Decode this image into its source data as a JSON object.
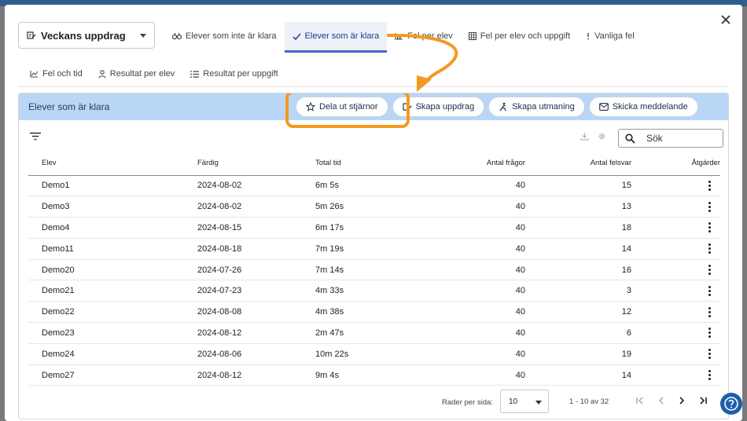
{
  "header": {
    "select_value": "Veckans uppdrag",
    "tabs_row1": [
      {
        "label": "Elever som inte är klara",
        "icon": "binoculars-icon"
      },
      {
        "label": "Elever som är klara",
        "icon": "check-icon",
        "active": true
      },
      {
        "label": "Fel per elev",
        "icon": "chart-icon"
      },
      {
        "label": "Fel per elev och uppgift",
        "icon": "grid-icon"
      },
      {
        "label": "Vanliga fel",
        "icon": "exclamation-icon"
      }
    ],
    "tabs_row2": [
      {
        "label": "Fel och tid",
        "icon": "line-chart-icon"
      },
      {
        "label": "Resultat per elev",
        "icon": "person-icon"
      },
      {
        "label": "Resultat per uppgift",
        "icon": "list-icon"
      }
    ]
  },
  "panel": {
    "title": "Elever som är klara",
    "actions": [
      {
        "label": "Dela ut stjärnor",
        "icon": "star-icon"
      },
      {
        "label": "Skapa uppdrag",
        "icon": "edit-icon"
      },
      {
        "label": "Skapa utmaning",
        "icon": "climber-icon"
      },
      {
        "label": "Skicka meddelande",
        "icon": "mail-icon"
      }
    ],
    "search_placeholder": "Sök"
  },
  "table": {
    "columns": [
      "Elev",
      "Färdig",
      "Total tid",
      "Antal frågor",
      "Antal felsvar",
      "Åtgärder"
    ],
    "rows": [
      [
        "Demo1",
        "2024-08-02",
        "6m 5s",
        "40",
        "15"
      ],
      [
        "Demo3",
        "2024-08-02",
        "5m 26s",
        "40",
        "13"
      ],
      [
        "Demo4",
        "2024-08-15",
        "6m 17s",
        "40",
        "18"
      ],
      [
        "Demo11",
        "2024-08-18",
        "7m 19s",
        "40",
        "14"
      ],
      [
        "Demo20",
        "2024-07-26",
        "7m 14s",
        "40",
        "16"
      ],
      [
        "Demo21",
        "2024-07-23",
        "4m 33s",
        "40",
        "3"
      ],
      [
        "Demo22",
        "2024-08-08",
        "4m 38s",
        "40",
        "12"
      ],
      [
        "Demo23",
        "2024-08-12",
        "2m 47s",
        "40",
        "6"
      ],
      [
        "Demo24",
        "2024-08-06",
        "10m 22s",
        "40",
        "19"
      ],
      [
        "Demo27",
        "2024-08-12",
        "9m 4s",
        "40",
        "14"
      ]
    ]
  },
  "footer": {
    "rows_per_page_label": "Rader per sida:",
    "rows_per_page_value": "10",
    "range_text": "1 - 10 av 32"
  },
  "colors": {
    "highlight": "#f39a1e",
    "panel_header": "#b9d6f6",
    "active_tab": "#3d6fbd",
    "help_button": "#1d5ea8"
  }
}
